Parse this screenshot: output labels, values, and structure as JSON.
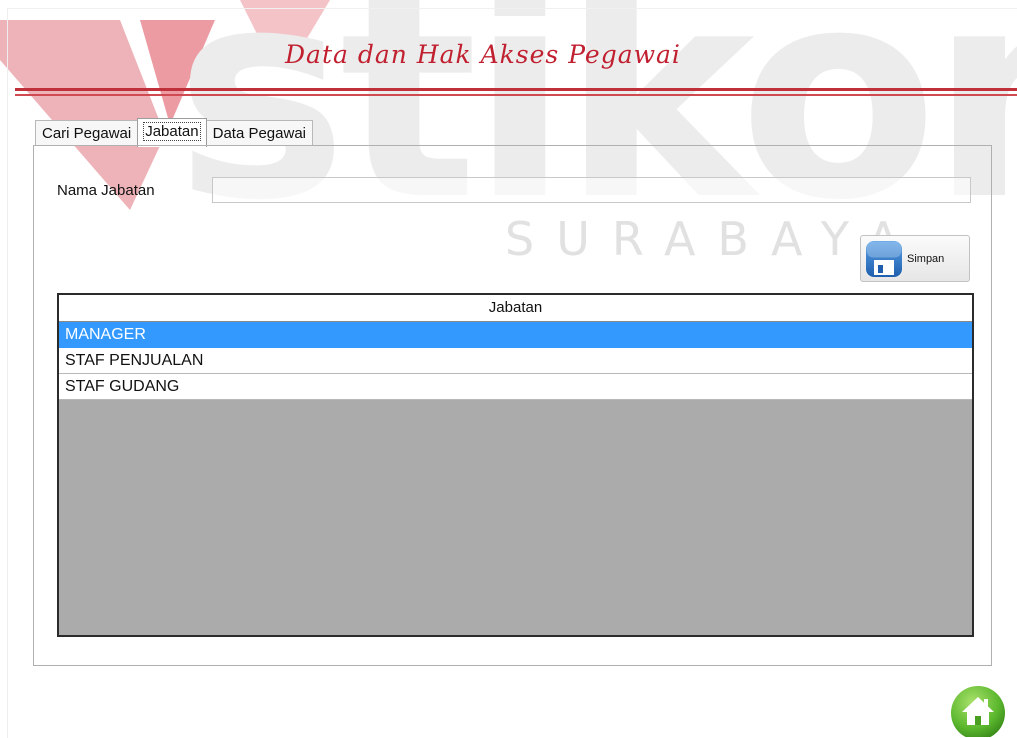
{
  "header": {
    "title": "Data dan Hak Akses Pegawai"
  },
  "watermark": {
    "subtitle": "SURABAYA"
  },
  "tabs": [
    {
      "label": "Cari Pegawai"
    },
    {
      "label": "Jabatan",
      "active": true
    },
    {
      "label": "Data Pegawai"
    }
  ],
  "form": {
    "nama_jabatan_label": "Nama Jabatan",
    "nama_jabatan_value": "",
    "save_label": "Simpan"
  },
  "table": {
    "header": "Jabatan",
    "rows": [
      "MANAGER",
      "STAF PENJUALAN",
      "STAF GUDANG"
    ],
    "selected_index": 0
  },
  "icons": {
    "save": "floppy-disk-icon",
    "home": "home-icon"
  },
  "colors": {
    "title": "#c02030",
    "selection": "#3399ff",
    "empty_area": "#ababab"
  }
}
